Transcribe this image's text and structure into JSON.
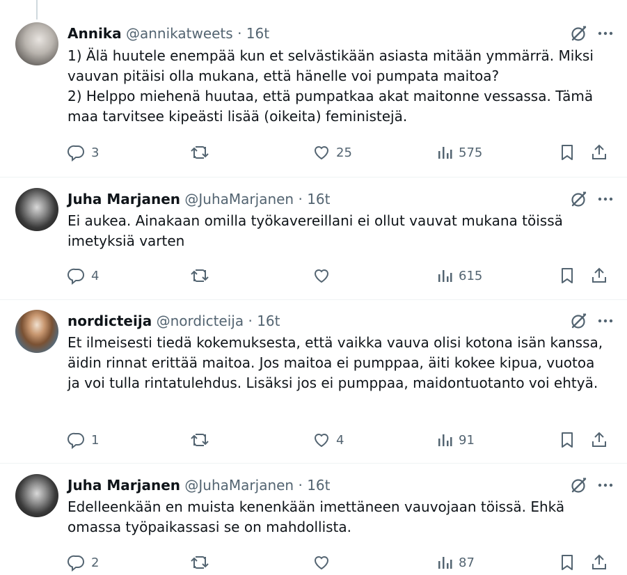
{
  "tweets": [
    {
      "name": "Annika",
      "handle": "@annikatweets",
      "separator": "·",
      "time": "16t",
      "avatar": "avatar-annika",
      "lines": [
        "1) Älä huutele enempää kun et selvästikään asiasta mitään ymmärrä. Miksi vauvan pitäisi olla mukana, että hänelle voi pumpata maitoa?",
        "2) Helppo miehenä huutaa, että pumpatkaa akat maitonne vessassa. Tämä maa tarvitsee kipeästi lisää (oikeita) feministejä."
      ],
      "replies": "3",
      "retweets": "",
      "likes": "25",
      "views": "575"
    },
    {
      "name": "Juha Marjanen",
      "handle": "@JuhaMarjanen",
      "separator": "·",
      "time": "16t",
      "avatar": "avatar-juha",
      "lines": [
        "Ei aukea. Ainakaan omilla työkavereillani ei ollut vauvat mukana töissä imetyksiä varten"
      ],
      "replies": "4",
      "retweets": "",
      "likes": "",
      "views": "615"
    },
    {
      "name": "nordicteija",
      "handle": "@nordicteija",
      "separator": "·",
      "time": "16t",
      "avatar": "avatar-nordicteija",
      "lines": [
        "Et ilmeisesti tiedä kokemuksesta, että vaikka vauva olisi kotona isän kanssa, äidin rinnat erittää maitoa. Jos maitoa ei pumppaa, äiti kokee kipua, vuotoa ja voi tulla rintatulehdus. Lisäksi jos ei pumppaa, maidontuotanto voi ehtyä."
      ],
      "replies": "1",
      "retweets": "",
      "likes": "4",
      "views": "91"
    },
    {
      "name": "Juha Marjanen",
      "handle": "@JuhaMarjanen",
      "separator": "·",
      "time": "16t",
      "avatar": "avatar-juha",
      "lines": [
        "Edelleenkään en muista kenenkään imettäneen vauvojaan töissä. Ehkä omassa työpaikassasi se on mahdollista."
      ],
      "replies": "2",
      "retweets": "",
      "likes": "",
      "views": "87"
    }
  ],
  "colors": {
    "text": "#0f1419",
    "secondary": "#536471",
    "divider": "#eff3f4"
  },
  "icons": [
    "reply-icon",
    "retweet-icon",
    "like-icon",
    "views-icon",
    "bookmark-icon",
    "share-icon",
    "grok-icon",
    "more-icon"
  ]
}
